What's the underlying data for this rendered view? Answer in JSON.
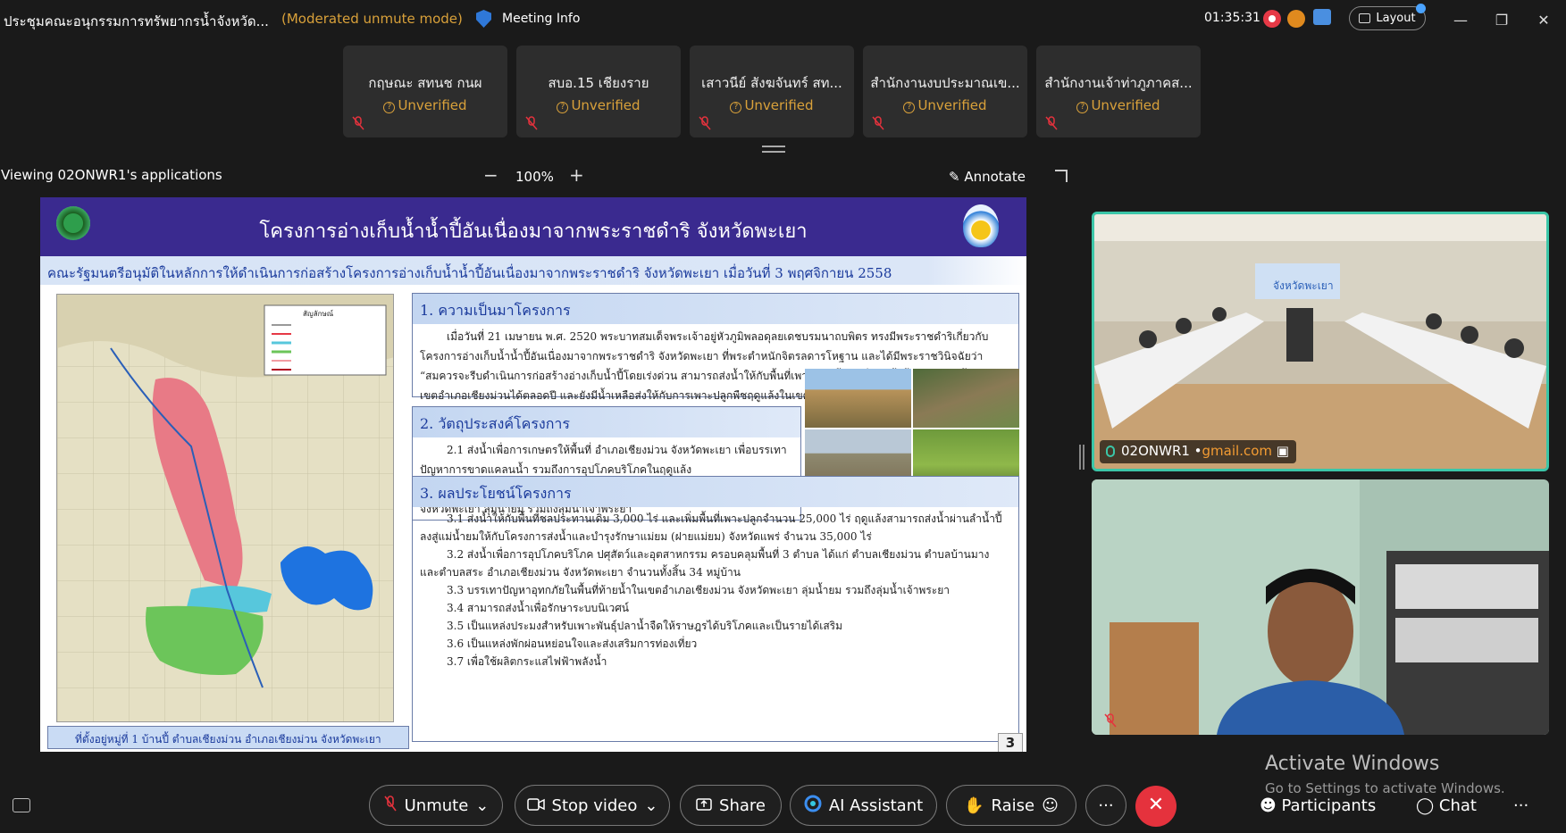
{
  "topbar": {
    "meeting_title": "ประชุมคณะอนุกรรมการทรัพยากรน้ำจังหวัด...",
    "mode": "(Moderated unmute mode)",
    "meeting_info": "Meeting Info",
    "timer": "01:35:31",
    "layout": "Layout"
  },
  "participants": [
    {
      "name": "กฤษณะ สทนช กนผ",
      "status": "Unverified"
    },
    {
      "name": "สบอ.15 เชียงราย",
      "status": "Unverified"
    },
    {
      "name": "เสาวนีย์ สังฆจันทร์ สท...",
      "status": "Unverified"
    },
    {
      "name": "สำนักงานงบประมาณเข...",
      "status": "Unverified"
    },
    {
      "name": "สำนักงานเจ้าท่าภูภาคส...",
      "status": "Unverified"
    }
  ],
  "viewing": {
    "label": "Viewing 02ONWR1's applications",
    "zoom": "100%",
    "annotate": "Annotate"
  },
  "slide": {
    "title": "โครงการอ่างเก็บน้ำน้ำปี้อันเนื่องมาจากพระราชดำริ จังหวัดพะเยา",
    "subtitle": "คณะรัฐมนตรีอนุมัติในหลักการให้ดำเนินการก่อสร้างโครงการอ่างเก็บน้ำน้ำปี้อันเนื่องมาจากพระราชดำริ จังหวัดพะเยา เมื่อวันที่ 3 พฤศจิกายน 2558",
    "map_caption": "ที่ตั้งอยู่หมู่ที่ 1 บ้านปี้ ตำบลเชียงม่วน อำเภอเชียงม่วน จังหวัดพะเยา",
    "map_legend_title": "สัญลักษณ์",
    "section1": {
      "heading": "1. ความเป็นมาโครงการ",
      "text": "เมื่อวันที่ 21 เมษายน พ.ศ. 2520 พระบาทสมเด็จพระเจ้าอยู่หัวภูมิพลอดุลยเดชบรมนาถบพิตร ทรงมีพระราชดำริเกี่ยวกับโครงการอ่างเก็บน้ำน้ำปี้อันเนื่องมาจากพระราชดำริ จังหวัดพะเยา ที่พระตำหนักจิตรลดารโหฐาน และได้มีพระราชวินิจฉัยว่า “สมควรจะรีบดำเนินการก่อสร้างอ่างเก็บน้ำปี้โดยเร่งด่วน สามารถส่งน้ำให้กับพื้นที่เพาะปลูกทั้งสองฝั่งแม่น้ำปี้ จนจรดแม่น้ำยมในเขตอำเภอเชียงม่วนได้ตลอดปี และยังมีน้ำเหลือส่งให้กับการเพาะปลูกพืชฤดูแล้งในเขตโครงการส่งน้ำและบำรุงรักษาแม่ยมได้อีกด้วย”"
    },
    "section2": {
      "heading": "2. วัตถุประสงค์โครงการ",
      "items": [
        "2.1 ส่งน้ำเพื่อการเกษตรให้พื้นที่ อำเภอเชียงม่วน จังหวัดพะเยา เพื่อบรรเทาปัญหาการขาดแคลนน้ำ รวมถึงการอุปโภคบริโภคในฤดูแล้ง",
        "2.2 เพื่อบรรเทาปัญหาน้ำท่วมด้านท้ายน้ำในฤดูฝนบริเวณอำเภอเชียงม่วน จังหวัดพะเยา ลุ่มน้ำยม รวมถึงลุ่มน้ำเจ้าพระยา"
      ]
    },
    "section3": {
      "heading": "3. ผลประโยชน์โครงการ",
      "items": [
        "3.1 ส่งน้ำให้กับพื้นที่ชลประทานเดิม 3,000 ไร่ และเพิ่มพื้นที่เพาะปลูกจำนวน 25,000 ไร่ ฤดูแล้งสามารถส่งน้ำผ่านลำน้ำปี้ลงสู่แม่น้ำยมให้กับโครงการส่งน้ำและบำรุงรักษาแม่ยม (ฝายแม่ยม) จังหวัดแพร่ จำนวน 35,000 ไร่",
        "3.2 ส่งน้ำเพื่อการอุปโภคบริโภค ปศุสัตว์และอุตสาหกรรม ครอบคลุมพื้นที่ 3 ตำบล ได้แก่ ตำบลเชียงม่วน ตำบลบ้านมาง และตำบลสระ อำเภอเชียงม่วน จังหวัดพะเยา จำนวนทั้งสิ้น 34 หมู่บ้าน",
        "3.3 บรรเทาปัญหาอุทกภัยในพื้นที่ท้ายน้ำในเขตอำเภอเชียงม่วน จังหวัดพะเยา ลุ่มน้ำยม รวมถึงลุ่มน้ำเจ้าพระยา",
        "3.4 สามารถส่งน้ำเพื่อรักษาระบบนิเวศน์",
        "3.5 เป็นแหล่งประมงสำหรับเพาะพันธุ์ปลาน้ำจืดให้ราษฎรได้บริโภคและเป็นรายได้เสริม",
        "3.6 เป็นแหล่งพักผ่อนหย่อนใจและส่งเสริมการท่องเที่ยว",
        "3.7 เพื่อใช้ผลิตกระแสไฟฟ้าพลังน้ำ"
      ]
    },
    "page_number": "3"
  },
  "videos": {
    "speaker_name": "02ONWR1 •",
    "speaker_domain": "gmail.com"
  },
  "watermark": {
    "line1": "Activate Windows",
    "line2": "Go to Settings to activate Windows."
  },
  "toolbar": {
    "unmute": "Unmute",
    "stop_video": "Stop video",
    "share": "Share",
    "ai_assistant": "AI Assistant",
    "raise": "Raise",
    "more": "···",
    "participants": "Participants",
    "chat": "Chat",
    "overflow": "···"
  },
  "colors": {
    "accent_active": "#3bc6a8",
    "warning": "#d9a13a",
    "leave": "#e5323d",
    "slide_header": "#3a2a8f"
  }
}
